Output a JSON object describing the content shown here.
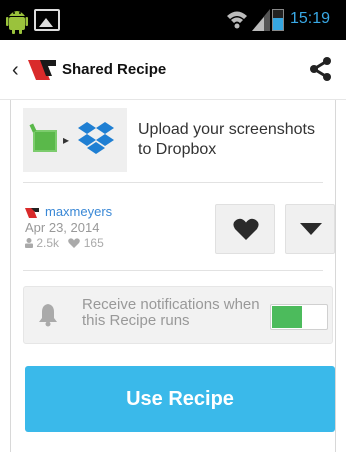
{
  "status_bar": {
    "time": "15:19",
    "icons": [
      "android-icon",
      "image-icon",
      "wifi-icon",
      "signal-icon",
      "battery-icon"
    ]
  },
  "action_bar": {
    "title": "Shared Recipe",
    "icons": [
      "back-chevron-icon",
      "ifttt-logo-icon",
      "share-icon"
    ]
  },
  "recipe": {
    "description": "Upload your screenshots to Dropbox",
    "trigger_icon": "android-image-icon",
    "action_icon": "dropbox-icon"
  },
  "author": {
    "name": "maxmeyers",
    "date": "Apr 23, 2014",
    "uses": "2.5k",
    "favorites": "165"
  },
  "notification": {
    "text": "Receive notifications when this Recipe runs",
    "enabled": true
  },
  "use_button_label": "Use Recipe",
  "colors": {
    "accent": "#3ab9ea",
    "toggle_on": "#4cbb5c",
    "link": "#3a88d6",
    "time": "#39a9e6"
  }
}
